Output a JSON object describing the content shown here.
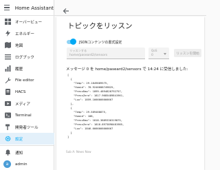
{
  "app": {
    "title": "Home Assistant"
  },
  "sidebar": {
    "items": [
      {
        "label": "オーバービュー",
        "icon": "overview-grid-icon"
      },
      {
        "label": "エネルギー",
        "icon": "lightning-bolt-icon"
      },
      {
        "label": "地図",
        "icon": "map-icon"
      },
      {
        "label": "ログブック",
        "icon": "logbook-list-icon"
      },
      {
        "label": "履歴",
        "icon": "history-chart-icon"
      },
      {
        "label": "File editor",
        "icon": "wrench-icon"
      },
      {
        "label": "HACS",
        "icon": "hacs-icon"
      },
      {
        "label": "メディア",
        "icon": "media-play-icon"
      },
      {
        "label": "Terminal",
        "icon": "terminal-console-icon"
      },
      {
        "label": "開発者ツール",
        "icon": "hammer-icon"
      },
      {
        "label": "設定",
        "icon": "gear-icon"
      }
    ],
    "notifications_label": "通知",
    "user_label": "admin",
    "user_initial": "a"
  },
  "main": {
    "title": "トピックをリッスン",
    "toggle_label": "JSONコンテンツの書式設定",
    "topic_field": {
      "label": "リッスンする",
      "value": "home/paseard2/sensors"
    },
    "qos_field": {
      "label": "QoS",
      "value": "0"
    },
    "listen_button": "リッスンを開始",
    "message_header": "メッセージ 0 を home/paseard2/sensors で 14:24 に受信しました:",
    "payload_1": "[\n  {\n    \"Temp\": 29.1849689575,\n    \"Humid\": 78.9246688749825,\n    \"PressRaw\": 1899.4894828792757,\n    \"PressZero\": 1817.9685489841961,\n    \"Lux\": 1859.1666666666667\n  },\n  {\n    \"Temp\": 29.589468875,\n    \"Humid\": 188,\n    \"PressRaw\": 1818.3889336319875,\n    \"PressZero\": 1818.8973898481985,\n    \"Lux\": 1846.6666666666667\n  }\n]",
    "footer": "Sub A: News Now"
  },
  "colors": {
    "accent": "#03a9f4",
    "active_bg": "#e1effa",
    "avatar": "#4b9dd7"
  }
}
